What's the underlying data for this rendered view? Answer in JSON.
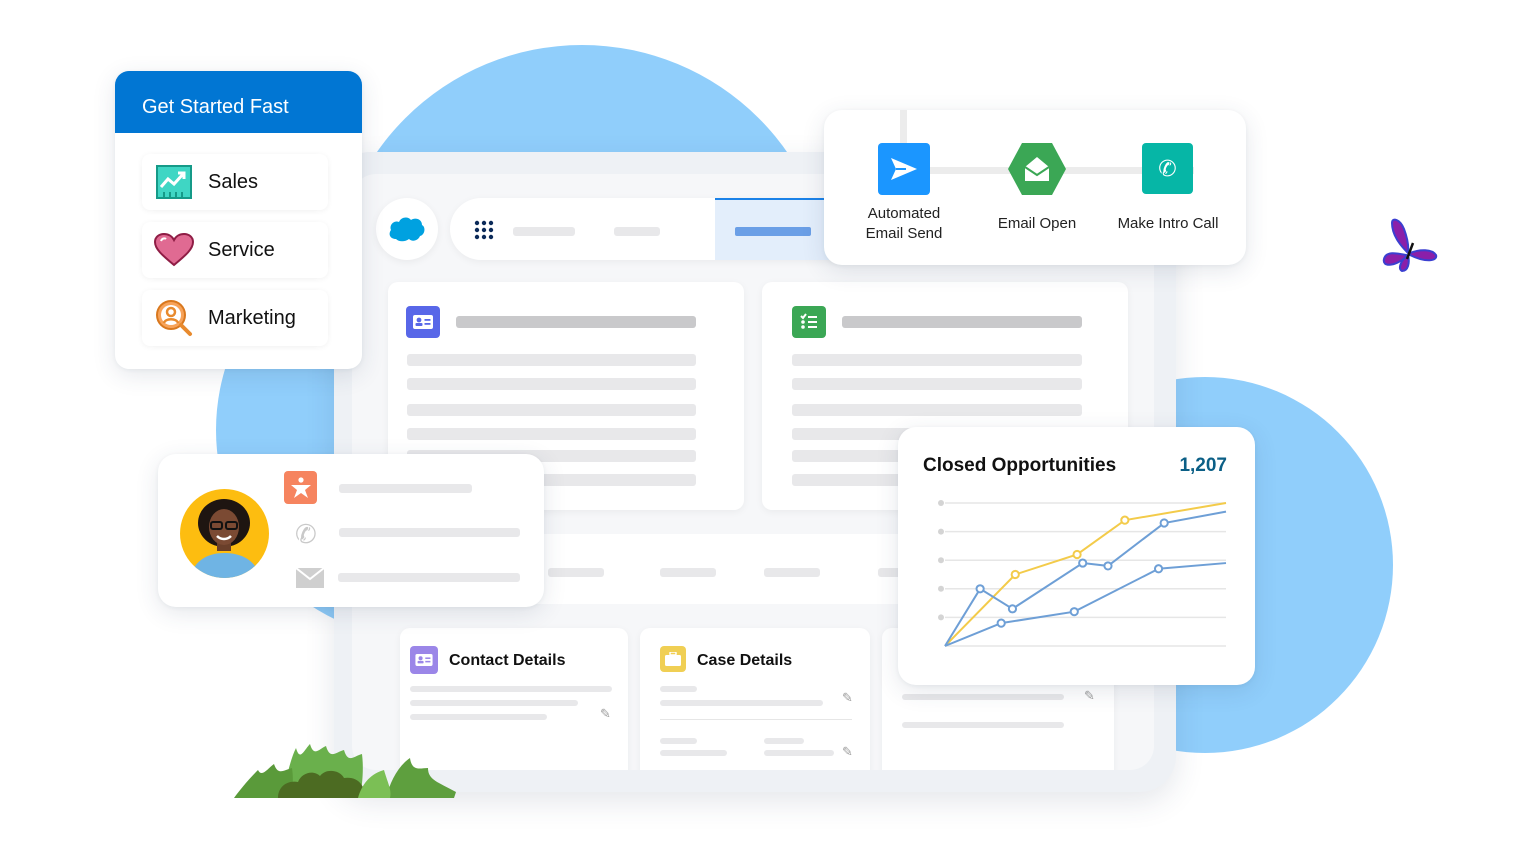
{
  "colors": {
    "brand_blue": "#0176d3",
    "sky_blue": "#90cefb",
    "chart_yellow": "#f3cb4a",
    "chart_blue": "#6e9fd6",
    "total_text": "#0b5f86"
  },
  "get_started": {
    "title": "Get Started Fast",
    "items": [
      {
        "label": "Sales",
        "icon": "trending-chart-icon"
      },
      {
        "label": "Service",
        "icon": "heart-icon"
      },
      {
        "label": "Marketing",
        "icon": "person-search-icon"
      }
    ]
  },
  "app_header": {
    "logo": "salesforce-cloud-icon",
    "launcher": "app-launcher-grid-icon"
  },
  "flow": {
    "steps": [
      {
        "label_line1": "Automated",
        "label_line2": "Email Send",
        "icon": "send-icon"
      },
      {
        "label_line1": "Email Open",
        "label_line2": "",
        "icon": "open-envelope-icon"
      },
      {
        "label_line1": "Make Intro Call",
        "label_line2": "",
        "icon": "phone-icon"
      }
    ]
  },
  "panels": {
    "left_icon": "contact-card-icon",
    "right_icon": "checklist-icon"
  },
  "profile": {
    "icons": [
      "accessibility-star-icon",
      "phone-icon",
      "email-icon"
    ]
  },
  "details": {
    "contact_title": "Contact Details",
    "case_title": "Case Details"
  },
  "chart_data": {
    "type": "line",
    "title": "Closed Opportunities",
    "total_label": "1,207",
    "xlabel": "",
    "ylabel": "",
    "xlim": [
      0,
      10
    ],
    "ylim": [
      0,
      5
    ],
    "grid": true,
    "legend": "none",
    "series": [
      {
        "name": "yellow",
        "color": "#f3cb4a",
        "points": [
          [
            0,
            0
          ],
          [
            2.5,
            2.5
          ],
          [
            4.7,
            3.2
          ],
          [
            6.4,
            4.4
          ],
          [
            10,
            5.0
          ]
        ],
        "markers": [
          1,
          2,
          3
        ]
      },
      {
        "name": "blue-upper",
        "color": "#6e9fd6",
        "points": [
          [
            0,
            0
          ],
          [
            1.25,
            2.0
          ],
          [
            2.4,
            1.3
          ],
          [
            4.9,
            2.9
          ],
          [
            5.8,
            2.8
          ],
          [
            7.8,
            4.3
          ],
          [
            10,
            4.7
          ]
        ],
        "markers": [
          1,
          2,
          3,
          4,
          5
        ]
      },
      {
        "name": "blue-lower",
        "color": "#6e9fd6",
        "points": [
          [
            0,
            0
          ],
          [
            2.0,
            0.8
          ],
          [
            4.6,
            1.2
          ],
          [
            7.6,
            2.7
          ],
          [
            10,
            2.9
          ]
        ],
        "markers": [
          1,
          2,
          3
        ]
      }
    ]
  }
}
